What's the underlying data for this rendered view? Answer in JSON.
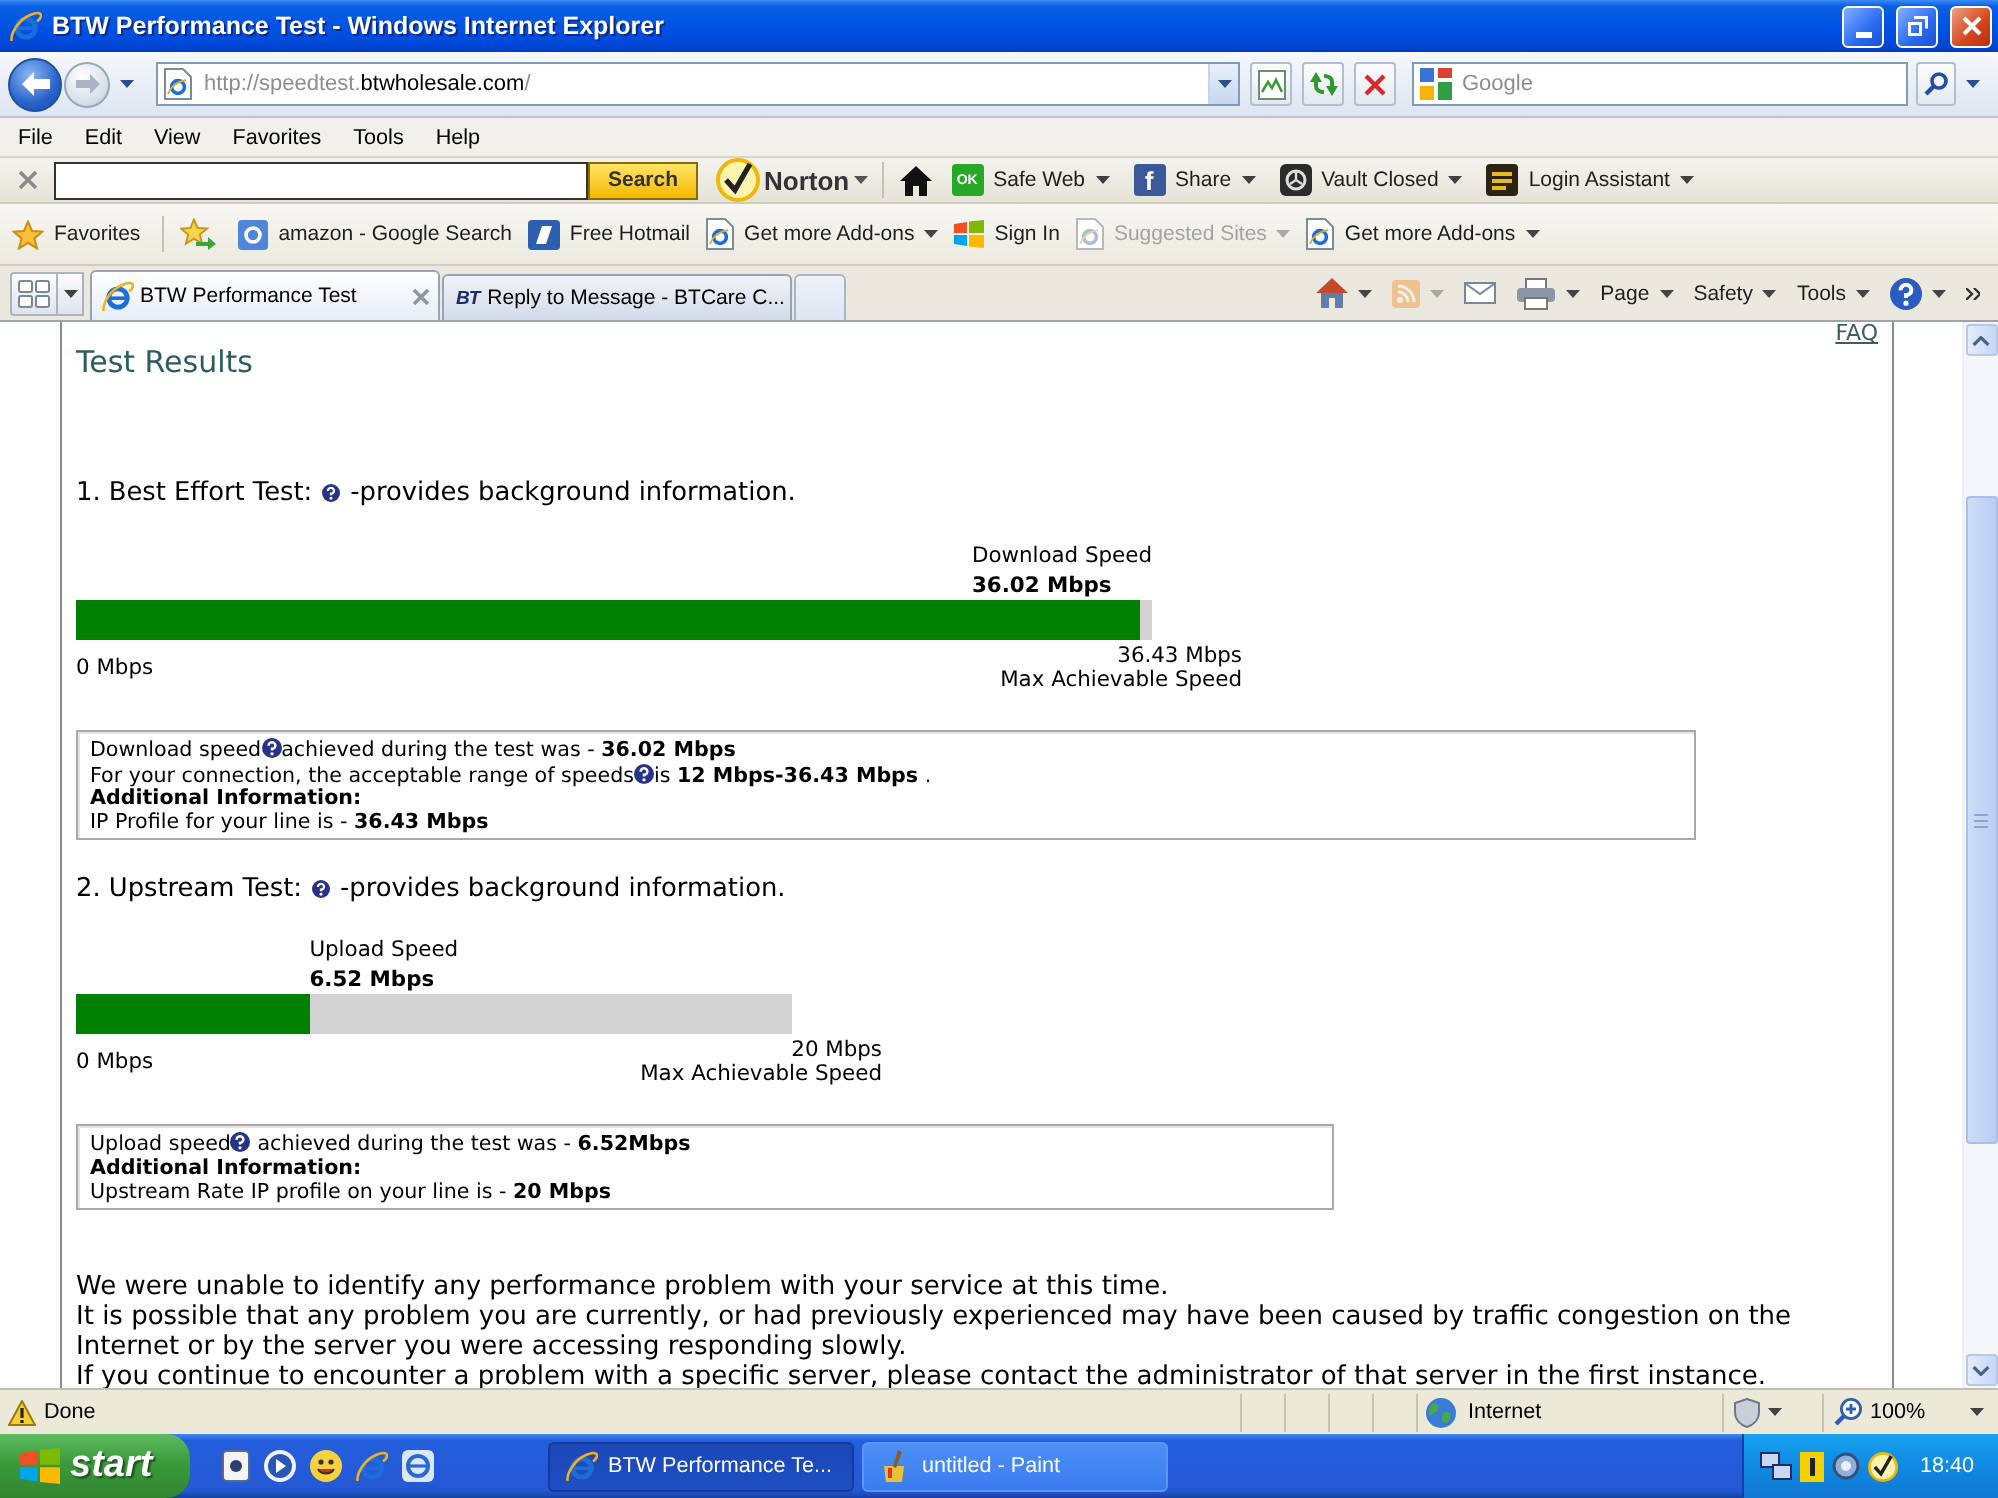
{
  "window": {
    "title": "BTW Performance Test - Windows Internet Explorer"
  },
  "address_bar": {
    "url_scheme": "http://speedtest.",
    "url_domain": "btwholesale.com",
    "url_path": "/",
    "search_placeholder": "Google"
  },
  "menu_bar": [
    "File",
    "Edit",
    "View",
    "Favorites",
    "Tools",
    "Help"
  ],
  "norton_toolbar": {
    "search_button": "Search",
    "brand": "Norton",
    "items": [
      {
        "kind": "home"
      },
      {
        "kind": "safe-web",
        "badge_text": "OK",
        "label": "Safe Web"
      },
      {
        "kind": "share",
        "badge_text": "f",
        "label": "Share"
      },
      {
        "kind": "vault",
        "label": "Vault Closed"
      },
      {
        "kind": "login",
        "label": "Login Assistant"
      }
    ]
  },
  "favorites_bar": {
    "button": "Favorites",
    "items": [
      {
        "kind": "search",
        "label": "amazon - Google Search",
        "dropdown": false,
        "disabled": false
      },
      {
        "kind": "mail",
        "label": "Free Hotmail",
        "dropdown": false,
        "disabled": false
      },
      {
        "kind": "page",
        "label": "Get more Add-ons",
        "dropdown": true,
        "disabled": false
      },
      {
        "kind": "flag",
        "label": "Sign In",
        "dropdown": false,
        "disabled": false
      },
      {
        "kind": "page",
        "label": "Suggested Sites",
        "dropdown": true,
        "disabled": true
      },
      {
        "kind": "page",
        "label": "Get more Add-ons",
        "dropdown": true,
        "disabled": false
      }
    ]
  },
  "tabs": [
    {
      "kind": "browser",
      "label": "BTW Performance Test",
      "selected": true
    },
    {
      "kind": "logo",
      "logo_text": "BT",
      "label": "Reply to Message - BTCare C...",
      "selected": false
    }
  ],
  "command_bar": [
    {
      "kind": "home",
      "dropdown": true,
      "disabled": false
    },
    {
      "kind": "feed",
      "dropdown": true,
      "disabled": true
    },
    {
      "kind": "mail",
      "dropdown": false,
      "disabled": false
    },
    {
      "kind": "print",
      "dropdown": true,
      "disabled": false
    },
    {
      "kind": "menu",
      "label": "Page",
      "dropdown": true,
      "disabled": false
    },
    {
      "kind": "menu",
      "label": "Safety",
      "dropdown": true,
      "disabled": false
    },
    {
      "kind": "menu",
      "label": "Tools",
      "dropdown": true,
      "disabled": false
    },
    {
      "kind": "help",
      "dropdown": true,
      "disabled": false
    }
  ],
  "page": {
    "faq_link": "FAQ",
    "heading": "Test Results",
    "tests": [
      {
        "title": "1. Best Effort Test:",
        "note": "-provides background information.",
        "speed_label": "Download Speed",
        "speed": "36.02 Mbps",
        "level": 0.989,
        "min": "0 Mbps",
        "max": "36.43 Mbps",
        "max_label": "Max Achievable Speed",
        "details": [
          {
            "kind": "text",
            "parts": [
              "Download speed",
              "achieved during the test was - **36.02 Mbps**"
            ]
          },
          {
            "kind": "text",
            "parts": [
              "For your connection, the acceptable range of speeds",
              "is **12 Mbps-36.43 Mbps** ."
            ]
          },
          {
            "kind": "heading",
            "parts": [
              "Additional Information:"
            ]
          },
          {
            "kind": "text",
            "parts": [
              "IP Profile for your line is - **36.43 Mbps**"
            ]
          }
        ]
      },
      {
        "title": "2. Upstream Test:",
        "note": "-provides background information.",
        "speed_label": "Upload Speed",
        "speed": "6.52 Mbps",
        "level": 0.326,
        "min": "0 Mbps",
        "max": "20 Mbps",
        "max_label": "Max Achievable Speed",
        "details": [
          {
            "kind": "text",
            "parts": [
              "Upload speed",
              " achieved during the test was - **6.52Mbps**"
            ]
          },
          {
            "kind": "heading",
            "parts": [
              "Additional Information:"
            ]
          },
          {
            "kind": "text",
            "parts": [
              "Upstream Rate IP profile on your line is - **20 Mbps**"
            ]
          }
        ]
      }
    ],
    "summary": [
      "We were unable to identify any performance problem with your service at this time.",
      "It is possible that any problem you are currently, or had previously experienced may have been caused by traffic congestion on the Internet or by the server you were accessing responding slowly.",
      "If you continue to encounter a problem with a specific server, please contact the administrator of that server in the first instance."
    ]
  },
  "status_bar": {
    "text": "Done",
    "zone": "Internet",
    "zoom": "100%"
  },
  "taskbar": {
    "start": "start",
    "tasks": [
      {
        "kind": "browser",
        "label": "BTW Performance Te...",
        "selected": true
      },
      {
        "kind": "paint",
        "label": "untitled - Paint",
        "selected": false
      }
    ],
    "clock": "18:40"
  }
}
